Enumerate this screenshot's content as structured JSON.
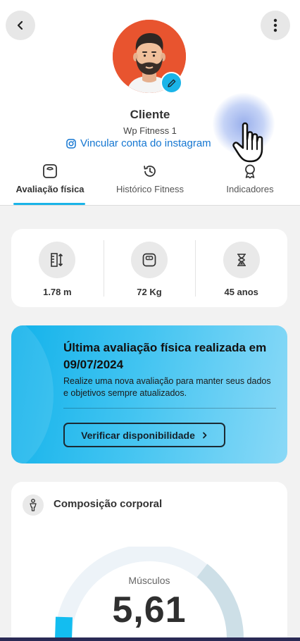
{
  "profile": {
    "name": "Cliente",
    "gym": "Wp Fitness 1",
    "instagram_link": "Vincular conta do instagram"
  },
  "icons": {
    "back": "chevron-left-icon",
    "more": "more-vertical-icon",
    "edit": "pencil-icon",
    "instagram": "instagram-icon"
  },
  "tabs": [
    {
      "label": "Avaliação física",
      "icon": "scale-icon",
      "active": true
    },
    {
      "label": "Histórico Fitness",
      "icon": "history-icon",
      "active": false
    },
    {
      "label": "Indicadores",
      "icon": "award-icon",
      "active": false
    }
  ],
  "stats": [
    {
      "value": "1.78 m",
      "icon": "height-icon"
    },
    {
      "value": "72 Kg",
      "icon": "weight-scale-icon"
    },
    {
      "value": "45 anos",
      "icon": "hourglass-icon"
    }
  ],
  "evaluation": {
    "title": "Última avaliação física realizada em  09/07/2024",
    "description": "Realize uma nova avaliação para manter seus dados e objetivos sempre atualizados.",
    "button": "Verificar disponibilidade"
  },
  "composition": {
    "title": "Composição corporal",
    "gauge_label": "Músculos",
    "gauge_value": "5,61"
  },
  "colors": {
    "accent": "#1ab4e8",
    "link": "#1476d1",
    "avatar_bg": "#e8542f"
  }
}
